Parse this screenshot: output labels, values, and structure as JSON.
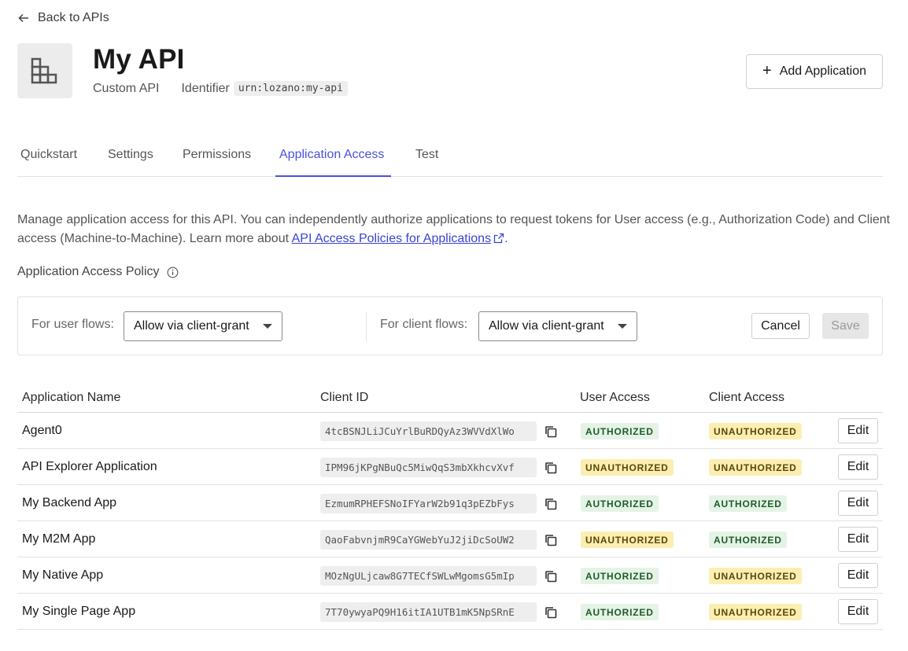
{
  "nav": {
    "back_label": "Back to APIs"
  },
  "api": {
    "title": "My API",
    "type": "Custom API",
    "identifier_label": "Identifier",
    "identifier": "urn:lozano:my-api",
    "icon": "building-icon"
  },
  "header": {
    "add_application_label": "Add Application"
  },
  "tabs": [
    {
      "label": "Quickstart",
      "active": false
    },
    {
      "label": "Settings",
      "active": false
    },
    {
      "label": "Permissions",
      "active": false
    },
    {
      "label": "Application Access",
      "active": true
    },
    {
      "label": "Test",
      "active": false
    }
  ],
  "description": {
    "text": "Manage application access for this API. You can independently authorize applications to request tokens for User access (e.g., Authorization Code) and Client access (Machine-to-Machine). Learn more about ",
    "link_text": "API Access Policies for Applications",
    "suffix": "."
  },
  "policy": {
    "label": "Application Access Policy",
    "user_flows_label": "For user flows:",
    "user_flows_value": "Allow via client-grant",
    "client_flows_label": "For client flows:",
    "client_flows_value": "Allow via client-grant",
    "cancel_label": "Cancel",
    "save_label": "Save"
  },
  "table": {
    "headers": [
      "Application Name",
      "Client ID",
      "User Access",
      "Client Access"
    ],
    "edit_label": "Edit",
    "rows": [
      {
        "name": "Agent0",
        "client_id": "4tcBSNJLiJCuYrlBuRDQyAz3WVVdXlWo",
        "user_access": "AUTHORIZED",
        "client_access": "UNAUTHORIZED"
      },
      {
        "name": "API Explorer Application",
        "client_id": "IPM96jKPgNBuQc5MiwQqS3mbXkhcvXvf",
        "user_access": "UNAUTHORIZED",
        "client_access": "UNAUTHORIZED"
      },
      {
        "name": "My Backend App",
        "client_id": "EzmumRPHEFSNoIFYarW2b91q3pEZbFys",
        "user_access": "AUTHORIZED",
        "client_access": "AUTHORIZED"
      },
      {
        "name": "My M2M App",
        "client_id": "QaoFabvnjmR9CaYGWebYuJ2jiDcSoUW2",
        "user_access": "UNAUTHORIZED",
        "client_access": "AUTHORIZED"
      },
      {
        "name": "My Native App",
        "client_id": "MOzNgULjcaw8G7TECfSWLwMgomsG5mIp",
        "user_access": "AUTHORIZED",
        "client_access": "UNAUTHORIZED"
      },
      {
        "name": "My Single Page App",
        "client_id": "7T70ywyaPQ9H16itIA1UTB1mK5NpSRnE",
        "user_access": "AUTHORIZED",
        "client_access": "UNAUTHORIZED"
      }
    ]
  },
  "colors": {
    "accent": "#4a52d9",
    "authorized_bg": "#e4f3e6",
    "authorized_text": "#1f5b2b",
    "unauthorized_bg": "#fbeeb0",
    "unauthorized_text": "#5a4708"
  }
}
